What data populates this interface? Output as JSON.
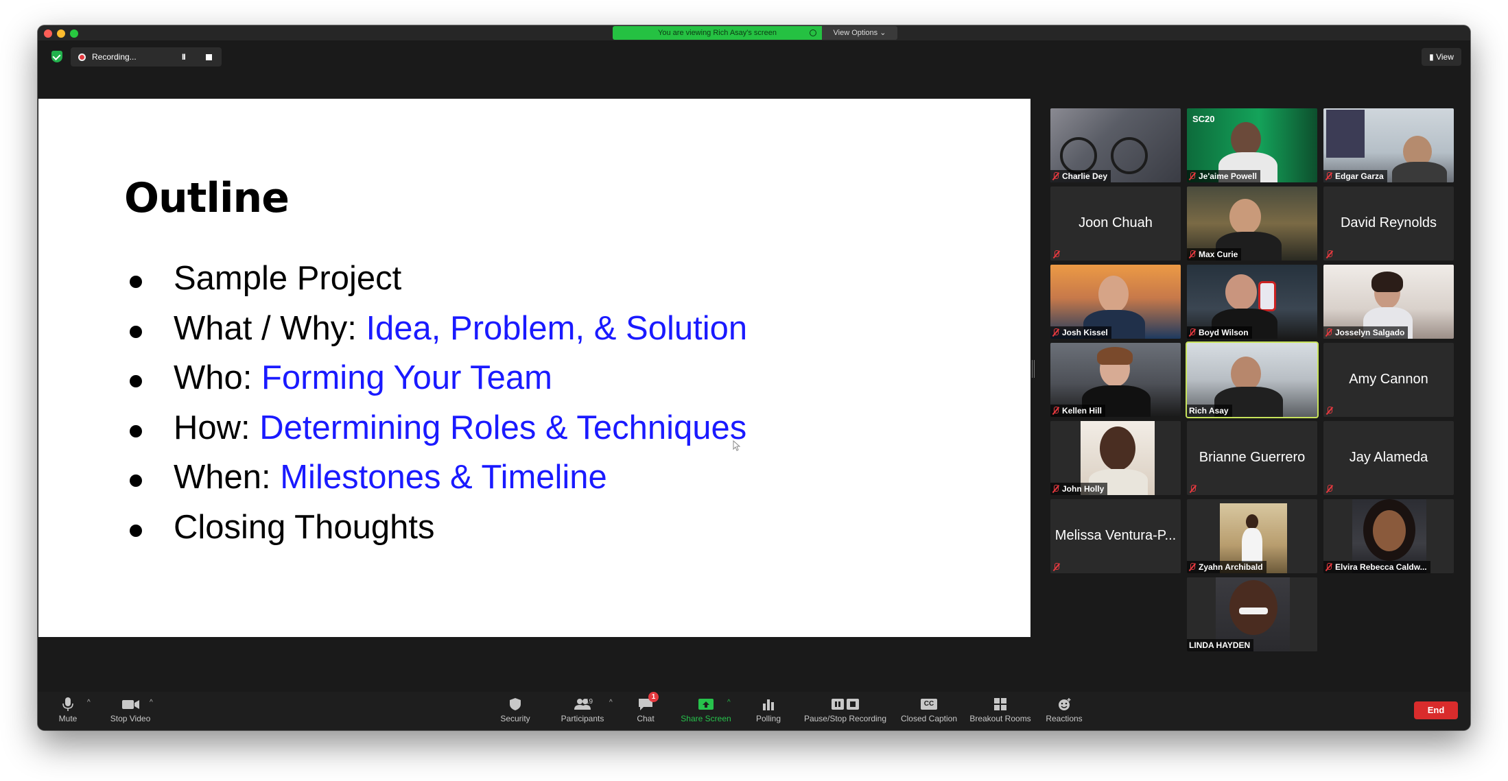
{
  "titlebar": {
    "viewing_banner": "You are viewing Rich Asay's screen",
    "view_options": "View Options ⌄"
  },
  "recording": {
    "label": "Recording...",
    "pause_glyph": "II"
  },
  "view_button": "View",
  "slide": {
    "title": "Outline",
    "bullets": [
      {
        "prefix": "Sample Project",
        "link": ""
      },
      {
        "prefix": "What / Why: ",
        "link": "Idea, Problem, & Solution"
      },
      {
        "prefix": "Who: ",
        "link": "Forming Your Team"
      },
      {
        "prefix": "How: ",
        "link": "Determining Roles & Techniques"
      },
      {
        "prefix": "When: ",
        "link": "Milestones & Timeline"
      },
      {
        "prefix": "Closing Thoughts",
        "link": ""
      }
    ]
  },
  "participants": [
    {
      "name": "Charlie Dey",
      "video": true
    },
    {
      "name": "Je'aime Powell",
      "video": true
    },
    {
      "name": "Edgar Garza",
      "video": true
    },
    {
      "name": "Joon Chuah",
      "video": false
    },
    {
      "name": "Max Curie",
      "video": true
    },
    {
      "name": "David Reynolds",
      "video": false
    },
    {
      "name": "Josh Kissel",
      "video": true
    },
    {
      "name": "Boyd Wilson",
      "video": true
    },
    {
      "name": "Josselyn Salgado",
      "video": true
    },
    {
      "name": "Kellen Hill",
      "video": true
    },
    {
      "name": "Rich Asay",
      "video": true,
      "active": true
    },
    {
      "name": "Amy Cannon",
      "video": false
    },
    {
      "name": "John Holly",
      "video": true
    },
    {
      "name": "Brianne Guerrero",
      "video": false
    },
    {
      "name": "Jay Alameda",
      "video": false
    },
    {
      "name": "Melissa Ventura-P...",
      "video": false
    },
    {
      "name": "Zyahn Archibald",
      "video": true
    },
    {
      "name": "Elvira Rebecca Caldw...",
      "video": true
    },
    {
      "name": "LINDA HAYDEN",
      "video": true
    }
  ],
  "toolbar": {
    "mute": "Mute",
    "stop_video": "Stop Video",
    "security": "Security",
    "participants": "Participants",
    "participants_count": "19",
    "chat": "Chat",
    "chat_badge": "1",
    "share_screen": "Share Screen",
    "polling": "Polling",
    "pause_stop_recording": "Pause/Stop Recording",
    "closed_caption": "Closed Caption",
    "closed_caption_glyph": "CC",
    "breakout_rooms": "Breakout Rooms",
    "reactions": "Reactions",
    "end": "End"
  },
  "colors": {
    "share_green": "#27c24c",
    "end_red": "#d92c2c",
    "active_speaker": "#c8e35b",
    "link_blue": "#1a1aff"
  }
}
